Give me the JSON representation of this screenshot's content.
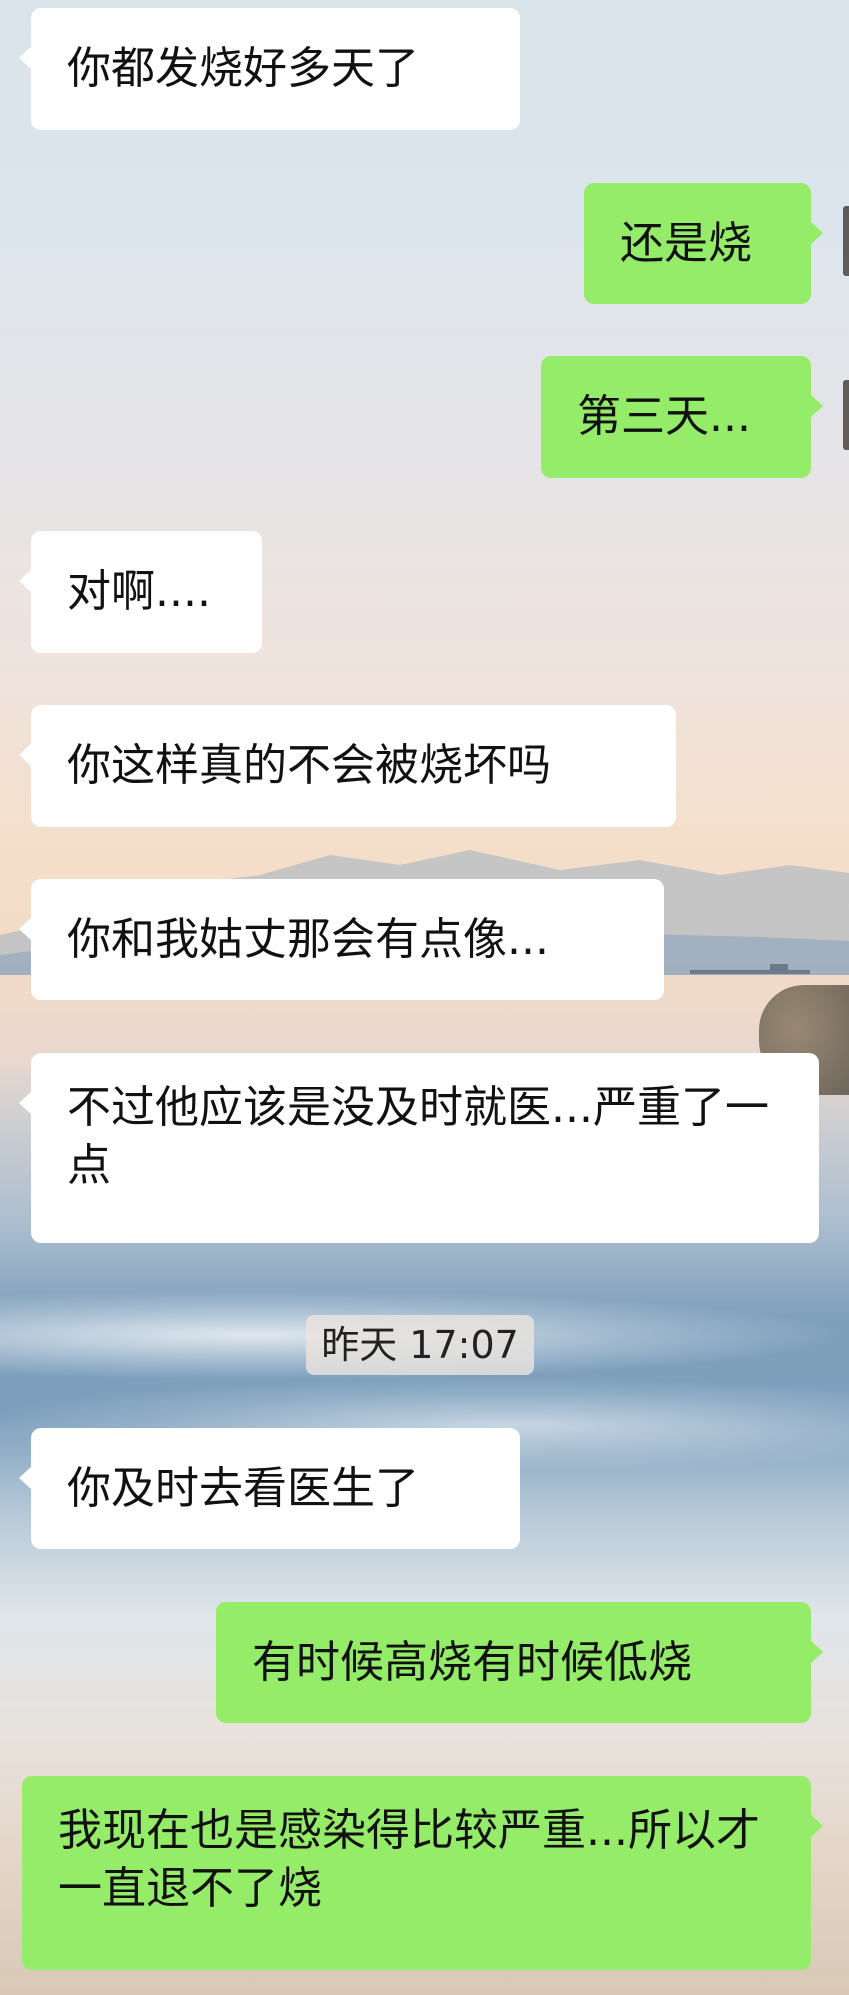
{
  "chat": {
    "messages": [
      {
        "side": "in",
        "text": "你都发烧好多天了"
      },
      {
        "side": "out",
        "text": "还是烧"
      },
      {
        "side": "out",
        "text": "第三天..."
      },
      {
        "side": "in",
        "text": "对啊...."
      },
      {
        "side": "in",
        "text": "你这样真的不会被烧坏吗"
      },
      {
        "side": "in",
        "text": "你和我姑丈那会有点像..."
      },
      {
        "side": "in",
        "text": "不过他应该是没及时就医...严重了一点"
      },
      {
        "side": "in",
        "text": "你及时去看医生了"
      },
      {
        "side": "out",
        "text": "有时候高烧有时候低烧"
      },
      {
        "side": "out",
        "text": "我现在也是感染得比较严重...所以才一直退不了烧"
      }
    ],
    "timestamp": "昨天 17:07"
  },
  "colors": {
    "incoming_bubble": "#ffffff",
    "outgoing_bubble": "#95ec69"
  }
}
